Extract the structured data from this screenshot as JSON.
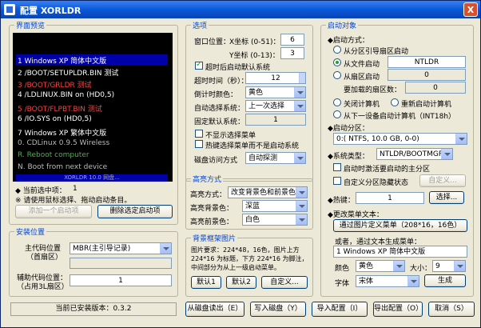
{
  "window": {
    "title": "配置 XORLDR",
    "close_glyph": "X"
  },
  "preview": {
    "group_title": "界面预览",
    "menu_items": [
      {
        "text": "1 Windows XP 简体中文版",
        "color": "#ffffff",
        "selected": true
      },
      {
        "text": "2 /BOOT/SETUPLDR.BIN 测试",
        "color": "#ffffff"
      },
      {
        "text": "3 /BOOT/GRLDR 测试",
        "color": "#ff4040"
      },
      {
        "text": "4 /LDLINUX.BIN on (HD0,5)",
        "color": "#ffffff"
      },
      {
        "text": "5 /BOOT/FLPBT.BIN 测试",
        "color": "#ff4040"
      },
      {
        "text": "6 /IO.SYS on (HD0,5)",
        "color": "#ffffff"
      },
      {
        "text": "7 Windows XP 繁体中文版",
        "color": "#ffffff"
      },
      {
        "text": "0. CDLinux 0.9.5 Wireless",
        "color": "#bbbbbb"
      },
      {
        "text": "R. Reboot computer",
        "color": "#4cb04c"
      },
      {
        "text": "N. Boot from next device",
        "color": "#bbbbbb"
      }
    ],
    "footer_text": "XORLDR 10.0 网盘...",
    "current_item_label": "◆ 当前选中项：",
    "current_item_value": "1",
    "hint": "※ 请使用鼠标选择、拖动启动条目。",
    "add_button": "添加一个启动项",
    "delete_button": "删除选定启动项"
  },
  "install": {
    "group_title": "安装位置",
    "main_code_label": "主代码位置",
    "main_code_label2": "（首扇区）",
    "main_code_value": "MBR(主引导记录)",
    "aux_code_label": "辅助代码位置：",
    "aux_code_label2": "（占用3L扇区）",
    "aux_code_value": "1"
  },
  "status": {
    "version_text": "当前已安装版本：0.3.2"
  },
  "options": {
    "group_title": "选项",
    "window_pos_label": "窗口位置：",
    "x_label": "X坐标 (0-51)：",
    "x_value": "6",
    "y_label": "Y坐标 (0-13)：",
    "y_value": "3",
    "timeout_enable": "超时后启动默认系统",
    "timeout_label": "超时时间（秒）：",
    "timeout_value": "12",
    "timer_color_label": "倒计时颜色：",
    "timer_color_value": "黄色",
    "auto_select_label": "自动选择系统：",
    "auto_select_value": "上一次选择",
    "fixed_default_label": "固定默认系统：",
    "fixed_default_value": "1",
    "hide_menu": "不显示选择菜单",
    "hotkey_menu": "热键选择菜单而不是启动系统",
    "disk_access_label": "磁盘访问方式",
    "disk_access_value": "自动探测"
  },
  "highlight": {
    "group_title": "高亮方式",
    "mode_label": "高亮方式：",
    "mode_value": "改变背景色和前景色",
    "bg_label": "高亮背景色：",
    "bg_value": "深蓝",
    "fg_label": "高亮前景色：",
    "fg_value": "白色"
  },
  "bgimage": {
    "group_title": "背景框架图片",
    "description": "图片要求：224*48，16色，图片上方224*16 为标题，下方 224*16 为脚注，中间部分为从上一级启动菜单。",
    "default1_button": "默认1",
    "default2_button": "默认2",
    "custom_button": "自定义..."
  },
  "target": {
    "group_title": "启动对象",
    "boot_mode_label": "◆启动方式：",
    "from_partition_boot_sector": "从分区引导扇区启动",
    "from_file": "从文件启动",
    "file_value": "NTLDR",
    "from_sector": "从扇区启动",
    "sector_value": "0",
    "sector_count_label": "要加载的扇区数：",
    "sector_count_value": "0",
    "shutdown": "关闭计算机",
    "restart": "重新启动计算机",
    "next_device": "从下一设备启动计算机（INT18h）",
    "partition_label": "◆启动分区：",
    "partition_value": "0:( NTFS,  10.0 GB, 0-0)",
    "system_type_label": "◆系统类型：",
    "system_type_value": "NTLDR/BOOTMGR",
    "set_primary": "启动时激活要启动的主分区",
    "custom_hide": "自定义分区隐藏状态",
    "custom_hide_button": "自定义...",
    "hotkey_label": "◆热键：",
    "hotkey_value": "1",
    "hotkey_select_button": "选择...",
    "change_text_label": "◆更改菜单文本：",
    "picture_button": "通过图片定义菜单（208*16，16色）",
    "or_text_label": "或者，通过文本生成菜单：",
    "menu_text_value": "1 Windows XP 简体中文版",
    "color_label": "颜色",
    "color_value": "黄色",
    "size_label": "大小：",
    "size_value": "9",
    "font_label": "字体",
    "font_value": "宋体",
    "generate_button": "生成"
  },
  "actions": {
    "read_disk": "从磁盘读出（E）",
    "write_disk": "写入磁盘（Y）",
    "import": "导入配置（I）",
    "export": "导出配置（O）",
    "cancel": "取消（S）"
  }
}
